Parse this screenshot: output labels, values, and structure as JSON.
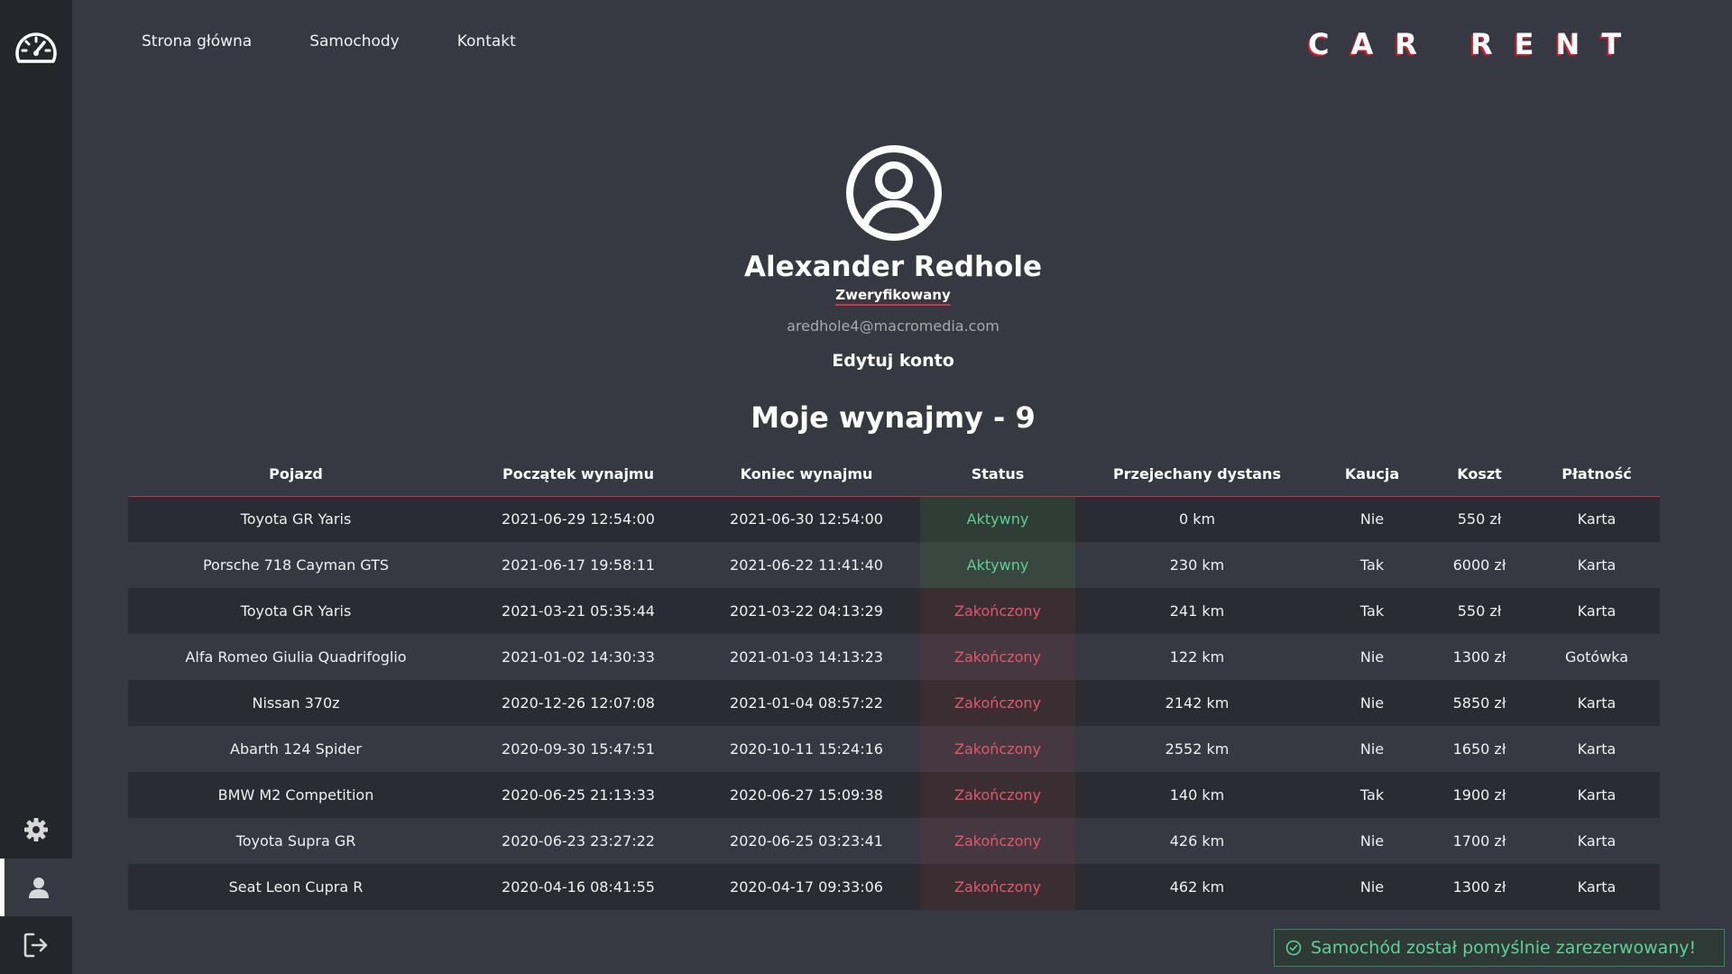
{
  "nav": {
    "links": [
      "Strona główna",
      "Samochody",
      "Kontakt"
    ],
    "brand": "CAR RENT"
  },
  "sidebar": {
    "icons": [
      "speedometer-icon",
      "gear-icon",
      "user-icon",
      "logout-icon"
    ]
  },
  "profile": {
    "name": "Alexander Redhole",
    "status": "Zweryfikowany",
    "email": "aredhole4@macromedia.com",
    "edit_label": "Edytuj konto"
  },
  "rentals": {
    "title": "Moje wynajmy - 9",
    "columns": [
      "Pojazd",
      "Początek wynajmu",
      "Koniec wynajmu",
      "Status",
      "Przejechany dystans",
      "Kaucja",
      "Koszt",
      "Płatność"
    ],
    "rows": [
      [
        "Toyota GR Yaris",
        "2021-06-29 12:54:00",
        "2021-06-30 12:54:00",
        "Aktywny",
        "0 km",
        "Nie",
        "550 zł",
        "Karta"
      ],
      [
        "Porsche 718 Cayman GTS",
        "2021-06-17 19:58:11",
        "2021-06-22 11:41:40",
        "Aktywny",
        "230 km",
        "Tak",
        "6000 zł",
        "Karta"
      ],
      [
        "Toyota GR Yaris",
        "2021-03-21 05:35:44",
        "2021-03-22 04:13:29",
        "Zakończony",
        "241 km",
        "Tak",
        "550 zł",
        "Karta"
      ],
      [
        "Alfa Romeo Giulia Quadrifoglio",
        "2021-01-02 14:30:33",
        "2021-01-03 14:13:23",
        "Zakończony",
        "122 km",
        "Nie",
        "1300 zł",
        "Gotówka"
      ],
      [
        "Nissan 370z",
        "2020-12-26 12:07:08",
        "2021-01-04 08:57:22",
        "Zakończony",
        "2142 km",
        "Nie",
        "5850 zł",
        "Karta"
      ],
      [
        "Abarth 124 Spider",
        "2020-09-30 15:47:51",
        "2020-10-11 15:24:16",
        "Zakończony",
        "2552 km",
        "Nie",
        "1650 zł",
        "Karta"
      ],
      [
        "BMW M2 Competition",
        "2020-06-25 21:13:33",
        "2020-06-27 15:09:38",
        "Zakończony",
        "140 km",
        "Tak",
        "1900 zł",
        "Karta"
      ],
      [
        "Toyota Supra GR",
        "2020-06-23 23:27:22",
        "2020-06-25 03:23:41",
        "Zakończony",
        "426 km",
        "Nie",
        "1700 zł",
        "Karta"
      ],
      [
        "Seat Leon Cupra R",
        "2020-04-16 08:41:55",
        "2020-04-17 09:33:06",
        "Zakończony",
        "462 km",
        "Nie",
        "1300 zł",
        "Karta"
      ]
    ]
  },
  "toast": {
    "message": "Samochód został pomyślnie zarezerwowany!"
  },
  "colors": {
    "background": "#363842",
    "sidebar": "#25262c",
    "accent_red": "#c81e2a",
    "active_green": "#5fcf8f",
    "finished_red": "#e0586a"
  }
}
